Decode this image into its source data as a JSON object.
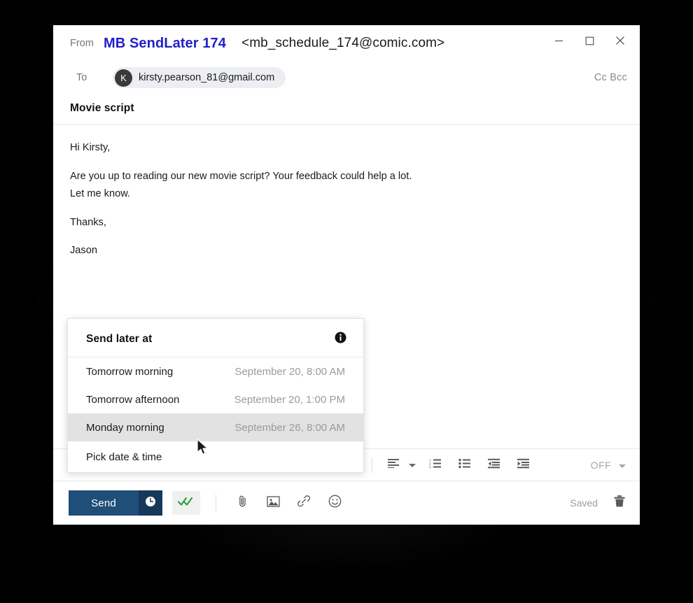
{
  "window": {
    "controls": [
      {
        "name": "minimize",
        "glyph": "minimize-icon"
      },
      {
        "name": "maximize",
        "glyph": "maximize-icon"
      },
      {
        "name": "close",
        "glyph": "close-icon"
      }
    ]
  },
  "compose": {
    "from_label": "From",
    "from_name": "MB SendLater 174",
    "from_address": "<mb_schedule_174@comic.com>",
    "to_label": "To",
    "recipient_initial": "K",
    "recipient": "kirsty.pearson_81@gmail.com",
    "cc_bcc_label": "Cc Bcc",
    "subject": "Movie script",
    "body": {
      "greeting": "Hi Kirsty,",
      "line1": "Are you up to reading our new movie script? Your feedback could help a lot.",
      "line2": "Let me know.",
      "closing": "Thanks,",
      "signature": "Jason"
    }
  },
  "format_toolbar": {
    "align_icon": "align-left-icon",
    "align_caret": "chevron-down-icon",
    "numbered_list_icon": "numbered-list-icon",
    "bullet_list_icon": "bullet-list-icon",
    "outdent_icon": "decrease-indent-icon",
    "indent_icon": "increase-indent-icon",
    "off_label": "OFF",
    "off_caret": "chevron-down-icon"
  },
  "action_bar": {
    "send_label": "Send",
    "send_schedule_icon": "clock-icon",
    "read_receipt_icon": "double-check-icon",
    "attach_icon": "paperclip-icon",
    "image_icon": "image-icon",
    "link_icon": "link-icon",
    "emoji_icon": "smiley-icon",
    "saved_label": "Saved",
    "delete_icon": "trash-icon"
  },
  "send_later_popup": {
    "title": "Send later at",
    "info_icon": "info-icon",
    "options": [
      {
        "label": "Tomorrow morning",
        "when": "September 20, 8:00 AM",
        "highlighted": false
      },
      {
        "label": "Tomorrow afternoon",
        "when": "September 20, 1:00 PM",
        "highlighted": false
      },
      {
        "label": "Monday morning",
        "when": "September 26, 8:00 AM",
        "highlighted": true
      },
      {
        "label": "Pick date & time",
        "when": "",
        "highlighted": false
      }
    ]
  },
  "colors": {
    "send_button": "#1f4e79",
    "send_clock": "#16385a",
    "from_name": "#2121c9",
    "check_green": "#2f9e44",
    "highlight_row": "#e2e2e2"
  }
}
